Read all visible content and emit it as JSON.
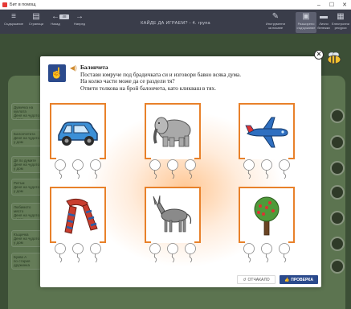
{
  "window": {
    "title": "Бит в помощ",
    "controls": {
      "minimize": "–",
      "maximize": "☐",
      "close": "✕"
    }
  },
  "toolbar": {
    "left_items": [
      {
        "label": "Съдържание",
        "icon": "menu-icon"
      },
      {
        "label": "Страници",
        "icon": "pages-icon"
      },
      {
        "label": "Назад",
        "icon": "arrow-left-icon"
      },
      {
        "label": "Напред",
        "icon": "arrow-right-icon"
      }
    ],
    "page_number": "48",
    "center_title": "КАЙДЕ ДА ИГРАЕМ? - 4. група",
    "right_items": [
      {
        "label": "Инструменти за писане",
        "icon": "pen-icon"
      },
      {
        "label": "Разширено съдържание",
        "icon": "expand-icon",
        "active": true
      },
      {
        "label": "Лични бележки",
        "icon": "folder-icon"
      },
      {
        "label": "Електронни ресурси",
        "icon": "resources-icon"
      }
    ]
  },
  "background_page": {
    "side_items": [
      {
        "label": "Думичка на куклата",
        "sub": "Деня на чудото у дом"
      },
      {
        "label": "Балончетата",
        "sub": "Деня на чудото у дом"
      },
      {
        "label": "Дя по думите",
        "sub": "Деня на чудото у дом"
      },
      {
        "label": "Ритъм",
        "sub": "Деня на чудото у дом"
      },
      {
        "label": "Любимото място",
        "sub": "Деня на чудото у дом"
      },
      {
        "label": "Къщичка",
        "sub": "Деня на чудото у дом"
      },
      {
        "label": "Буква А",
        "sub": "по стария дружинка"
      }
    ]
  },
  "modal": {
    "title": "Балончета",
    "instructions": [
      "Постави юмруче под брадичката си и изговори бавно всяка дума.",
      "На колко части може да се раздели тя?",
      "Ответи толкова на брой балончета, като кликваш в тях."
    ],
    "cards": [
      {
        "picture": "car",
        "balloons": 3
      },
      {
        "picture": "elephant",
        "balloons": 3
      },
      {
        "picture": "airplane",
        "balloons": 3
      },
      {
        "picture": "scarf",
        "balloons": 3
      },
      {
        "picture": "donkey",
        "balloons": 3
      },
      {
        "picture": "tree",
        "balloons": 3
      }
    ],
    "cancel_label": "ОТЧАКАЛО",
    "check_label": "ПРОВЕРКА",
    "colors": {
      "frame": "#e8812a",
      "primary": "#2b4a8c",
      "glow": "#ffbe82"
    }
  }
}
